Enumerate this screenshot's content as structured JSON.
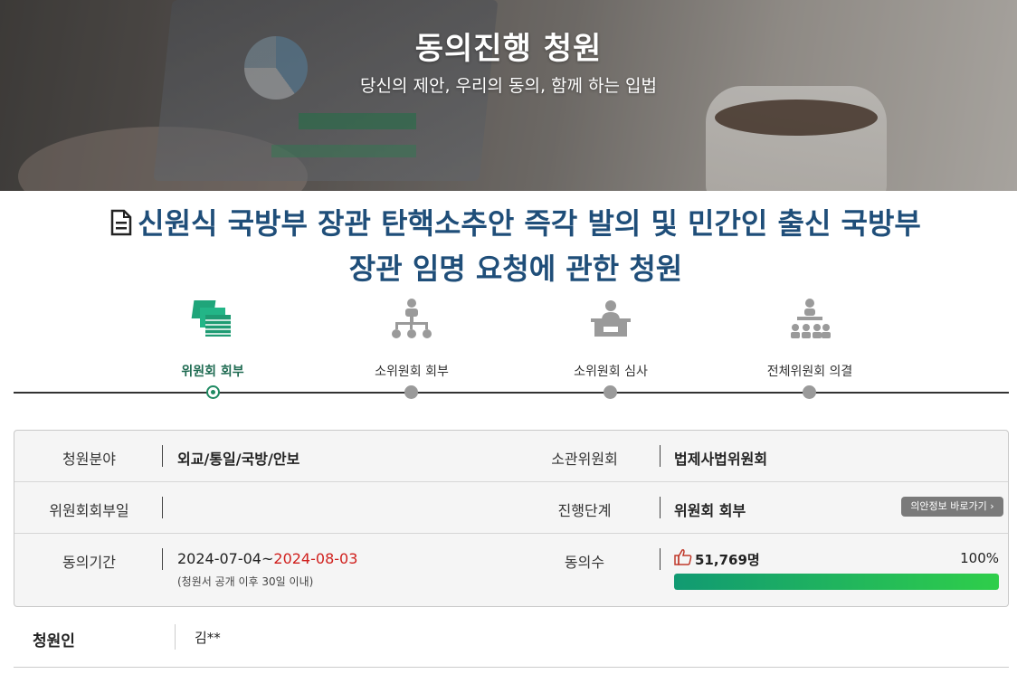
{
  "hero": {
    "title": "동의진행 청원",
    "subtitle": "당신의 제안, 우리의 동의, 함께 하는 입법"
  },
  "petition": {
    "title": "신원식 국방부 장관 탄핵소추안 즉각 발의 및 민간인 출신 국방부장관 임명 요청에 관한 청원"
  },
  "steps": [
    {
      "label": "위원회 회부",
      "icon": "documents-icon",
      "active": true
    },
    {
      "label": "소위원회 회부",
      "icon": "org-chart-icon",
      "active": false
    },
    {
      "label": "소위원회 심사",
      "icon": "podium-icon",
      "active": false
    },
    {
      "label": "전체위원회 의결",
      "icon": "assembly-icon",
      "active": false
    }
  ],
  "info": {
    "field_label": "청원분야",
    "field_value": "외교/통일/국방/안보",
    "committee_label": "소관위원회",
    "committee_value": "법제사법위원회",
    "referral_date_label": "위원회회부일",
    "referral_date_value": "",
    "stage_label": "진행단계",
    "stage_value": "위원회 회부",
    "bill_info_button": "의안정보 바로가기",
    "period_label": "동의기간",
    "period_start": "2024-07-04~",
    "period_end": "2024-08-03",
    "period_note": "(청원서 공개 이후 30일 이내)",
    "agree_label": "동의수",
    "agree_count": "51,769명",
    "agree_percent_text": "100%",
    "agree_percent": 100
  },
  "petitioner": {
    "label": "청원인",
    "value": "김**"
  },
  "colors": {
    "title_blue": "#1f4e79",
    "active_green": "#1f8a62",
    "deadline_red": "#d0201d",
    "bar_start": "#119a72",
    "bar_end": "#2fce4a"
  }
}
